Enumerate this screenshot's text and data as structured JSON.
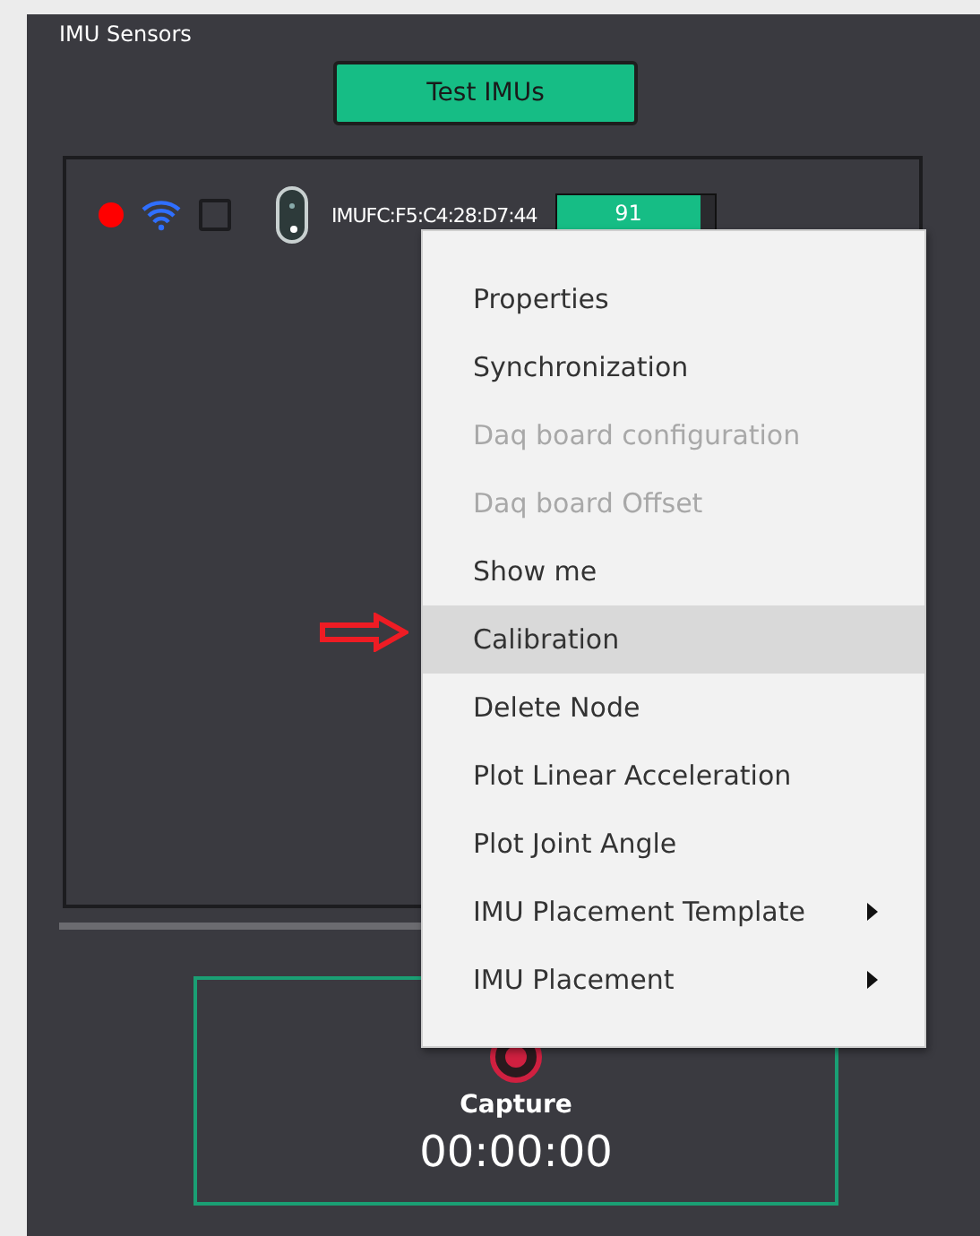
{
  "panel": {
    "title": "IMU Sensors"
  },
  "test_button": {
    "label": "Test IMUs"
  },
  "sensors": [
    {
      "color": "#ff0000",
      "checked": false,
      "name": "IMUFC:F5:C4:28:D7:44",
      "level": 0.91,
      "reading": "91"
    }
  ],
  "context_menu": {
    "items": [
      {
        "label": "Properties",
        "disabled": false,
        "selected": false,
        "submenu": false
      },
      {
        "label": "Synchronization",
        "disabled": false,
        "selected": false,
        "submenu": false
      },
      {
        "label": "Daq board configuration",
        "disabled": true,
        "selected": false,
        "submenu": false
      },
      {
        "label": "Daq board Offset",
        "disabled": true,
        "selected": false,
        "submenu": false
      },
      {
        "label": "Show me",
        "disabled": false,
        "selected": false,
        "submenu": false
      },
      {
        "label": "Calibration",
        "disabled": false,
        "selected": true,
        "submenu": false
      },
      {
        "label": "Delete Node",
        "disabled": false,
        "selected": false,
        "submenu": false
      },
      {
        "label": "Plot Linear Acceleration",
        "disabled": false,
        "selected": false,
        "submenu": false
      },
      {
        "label": "Plot Joint Angle",
        "disabled": false,
        "selected": false,
        "submenu": false
      },
      {
        "label": "IMU Placement Template",
        "disabled": false,
        "selected": false,
        "submenu": true
      },
      {
        "label": "IMU Placement",
        "disabled": false,
        "selected": false,
        "submenu": true
      }
    ]
  },
  "capture": {
    "label": "Capture",
    "time": "00:00:00"
  }
}
